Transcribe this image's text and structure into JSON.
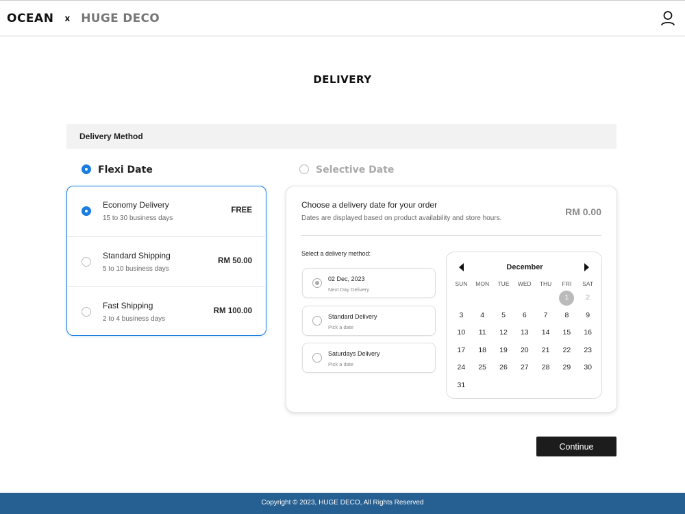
{
  "header": {
    "brand_primary": "OCEAN",
    "brand_separator": "x",
    "brand_secondary": "HUGE DECO"
  },
  "page": {
    "title": "DELIVERY"
  },
  "method_bar": {
    "label": "Delivery Method"
  },
  "date_options": [
    {
      "label": "Flexi Date",
      "selected": true
    },
    {
      "label": "Selective Date",
      "selected": false
    }
  ],
  "shipping_options": [
    {
      "name": "Economy Delivery",
      "description": "15 to 30 business days",
      "price": "FREE",
      "selected": true
    },
    {
      "name": "Standard Shipping",
      "description": "5 to 10 business days",
      "price": "RM 50.00",
      "selected": false
    },
    {
      "name": "Fast Shipping",
      "description": "2 to 4 business days",
      "price": "RM 100.00",
      "selected": false
    }
  ],
  "selective": {
    "heading": "Choose a delivery date for your order",
    "subheading": "Dates are displayed based on product availability and store hours.",
    "price": "RM 0.00",
    "method_label": "Select a delivery method:",
    "methods": [
      {
        "title": "02 Dec, 2023",
        "subtitle": "Next Day Delivery",
        "selected": true
      },
      {
        "title": "Standard Delivery",
        "subtitle": "Pick a date",
        "selected": false
      },
      {
        "title": "Saturdays Delivery",
        "subtitle": "Pick a date",
        "selected": false
      }
    ]
  },
  "calendar": {
    "month": "December",
    "weekdays": [
      "SUN",
      "MON",
      "TUE",
      "WED",
      "THU",
      "FRI",
      "SAT"
    ],
    "weeks": [
      [
        "",
        "",
        "",
        "",
        "",
        "1",
        "2"
      ],
      [
        "3",
        "4",
        "5",
        "6",
        "7",
        "8",
        "9"
      ],
      [
        "10",
        "11",
        "12",
        "13",
        "14",
        "15",
        "16"
      ],
      [
        "17",
        "18",
        "19",
        "20",
        "21",
        "22",
        "23"
      ],
      [
        "24",
        "25",
        "26",
        "27",
        "28",
        "29",
        "30"
      ],
      [
        "31",
        "",
        "",
        "",
        "",
        "",
        ""
      ]
    ],
    "selected_day": "1",
    "muted_days": [
      "2"
    ]
  },
  "actions": {
    "continue_label": "Continue"
  },
  "footer": {
    "copyright": "Copyright © 2023, HUGE DECO, All Rights Reserved"
  },
  "colors": {
    "accent": "#1a7de0",
    "footer_bg": "#265f91",
    "button_bg": "#1c1c1c"
  }
}
